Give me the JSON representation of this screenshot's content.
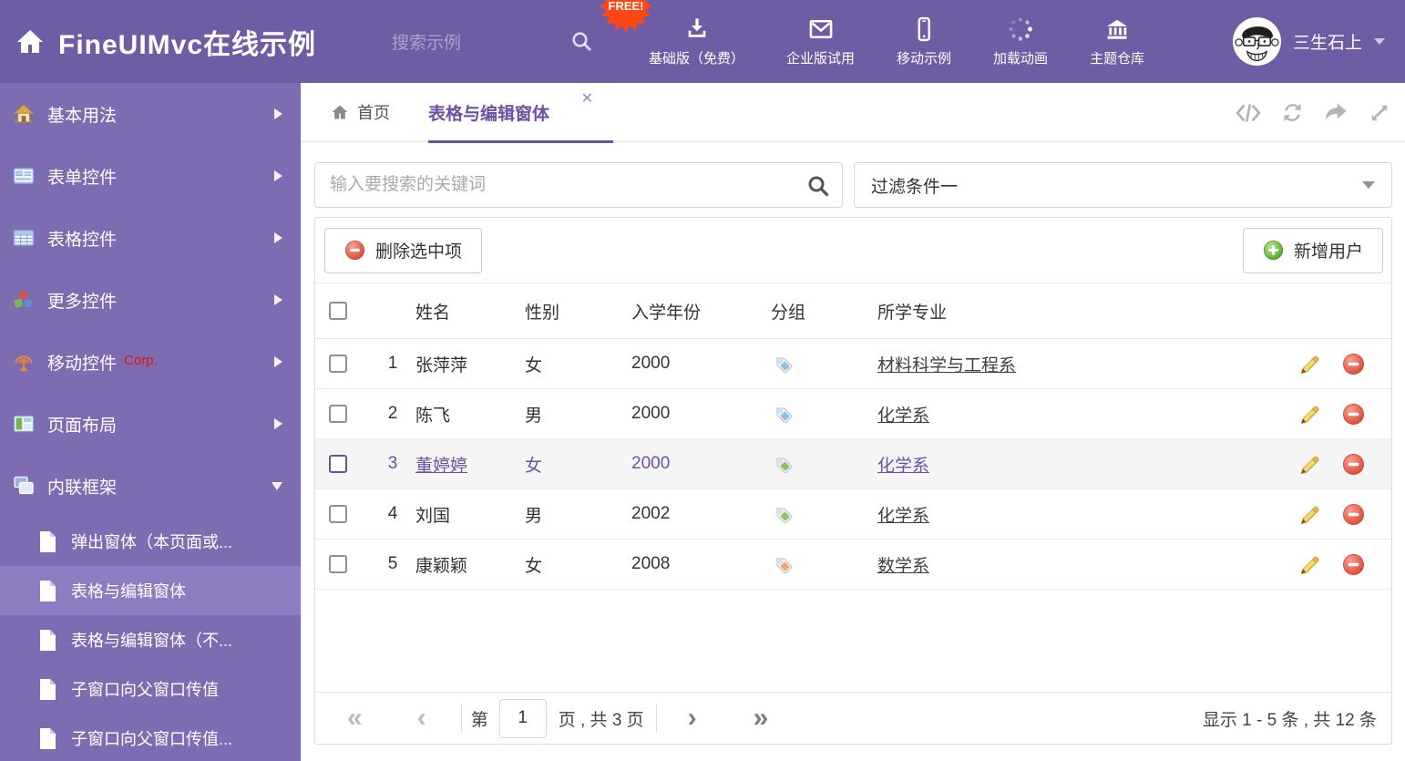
{
  "colors": {
    "header_bg": "#6e5ca4",
    "sidebar_bg": "#7d6cb2",
    "sidebar_selected_bg": "#8c7cc0",
    "accent": "#6b51a3",
    "free_badge": "#ff4713",
    "corp_red": "#e51400",
    "tag_blue": "#85c3ee",
    "tag_green": "#8cc063",
    "tag_orange": "#f2a964"
  },
  "header": {
    "title": "FineUIMvc在线示例",
    "search_placeholder": "搜索示例",
    "free_badge": "FREE!",
    "nav": [
      {
        "label": "基础版（免费）",
        "icon": "download-icon"
      },
      {
        "label": "企业版试用",
        "icon": "envelope-icon"
      },
      {
        "label": "移动示例",
        "icon": "mobile-icon"
      },
      {
        "label": "加载动画",
        "icon": "spinner-icon"
      },
      {
        "label": "主题仓库",
        "icon": "bank-icon"
      }
    ],
    "user": {
      "name": "三生石上"
    }
  },
  "sidebar": {
    "items": [
      {
        "label": "基本用法",
        "icon": "home-icon"
      },
      {
        "label": "表单控件",
        "icon": "form-icon"
      },
      {
        "label": "表格控件",
        "icon": "grid-icon"
      },
      {
        "label": "更多控件",
        "icon": "cubes-icon"
      },
      {
        "label": "移动控件",
        "badge": "Corp.",
        "icon": "antenna-icon"
      },
      {
        "label": "页面布局",
        "icon": "layout-icon"
      },
      {
        "label": "内联框架",
        "icon": "frames-icon",
        "expanded": true
      }
    ],
    "subitems": [
      {
        "label": "弹出窗体（本页面或..."
      },
      {
        "label": "表格与编辑窗体",
        "selected": true
      },
      {
        "label": "表格与编辑窗体（不..."
      },
      {
        "label": "子窗口向父窗口传值"
      },
      {
        "label": "子窗口向父窗口传值..."
      }
    ]
  },
  "tabs": {
    "home": "首页",
    "active": "表格与编辑窗体"
  },
  "filters": {
    "search_placeholder": "输入要搜索的关键词",
    "dropdown_value": "过滤条件一"
  },
  "toolbar": {
    "delete_label": "删除选中项",
    "add_label": "新增用户"
  },
  "table": {
    "columns": {
      "name": "姓名",
      "gender": "性别",
      "year": "入学年份",
      "group": "分组",
      "major": "所学专业"
    },
    "rows": [
      {
        "num": "1",
        "name": "张萍萍",
        "gender": "女",
        "year": "2000",
        "tag": "blue",
        "major": "材料科学与工程系"
      },
      {
        "num": "2",
        "name": "陈飞",
        "gender": "男",
        "year": "2000",
        "tag": "blue",
        "major": "化学系"
      },
      {
        "num": "3",
        "name": "董婷婷",
        "gender": "女",
        "year": "2000",
        "tag": "green",
        "major": "化学系",
        "selected": true
      },
      {
        "num": "4",
        "name": "刘国",
        "gender": "男",
        "year": "2002",
        "tag": "green",
        "major": "化学系"
      },
      {
        "num": "5",
        "name": "康颖颖",
        "gender": "女",
        "year": "2008",
        "tag": "orange",
        "major": "数学系"
      }
    ]
  },
  "pagination": {
    "label_page": "第",
    "current_page": "1",
    "label_total": "页 , 共 3 页",
    "summary": "显示 1 - 5 条 , 共 12 条"
  }
}
